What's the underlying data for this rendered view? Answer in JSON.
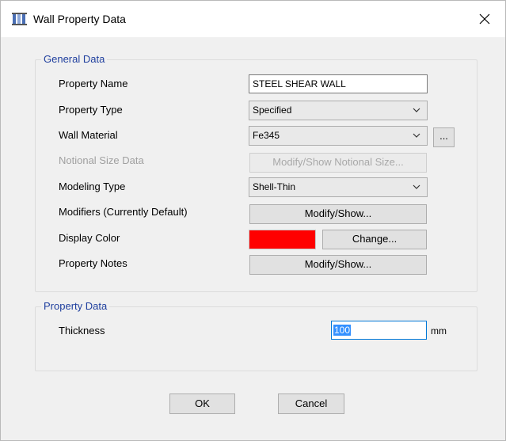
{
  "window": {
    "title": "Wall Property Data"
  },
  "general_data": {
    "legend": "General Data",
    "property_name": {
      "label": "Property Name",
      "value": "STEEL SHEAR WALL"
    },
    "property_type": {
      "label": "Property Type",
      "value": "Specified"
    },
    "wall_material": {
      "label": "Wall Material",
      "value": "Fe345",
      "browse_label": "..."
    },
    "notional_size": {
      "label": "Notional Size Data",
      "button_label": "Modify/Show Notional Size..."
    },
    "modeling_type": {
      "label": "Modeling Type",
      "value": "Shell-Thin"
    },
    "modifiers": {
      "label": "Modifiers (Currently Default)",
      "button_label": "Modify/Show..."
    },
    "display_color": {
      "label": "Display Color",
      "color": "#ff0000",
      "button_label": "Change..."
    },
    "property_notes": {
      "label": "Property Notes",
      "button_label": "Modify/Show..."
    }
  },
  "property_data": {
    "legend": "Property Data",
    "thickness": {
      "label": "Thickness",
      "value": "100",
      "unit": "mm"
    }
  },
  "footer": {
    "ok_label": "OK",
    "cancel_label": "Cancel"
  },
  "colors": {
    "accent": "#1f3f9e",
    "selection": "#3390ff",
    "focus_border": "#0078d7"
  }
}
